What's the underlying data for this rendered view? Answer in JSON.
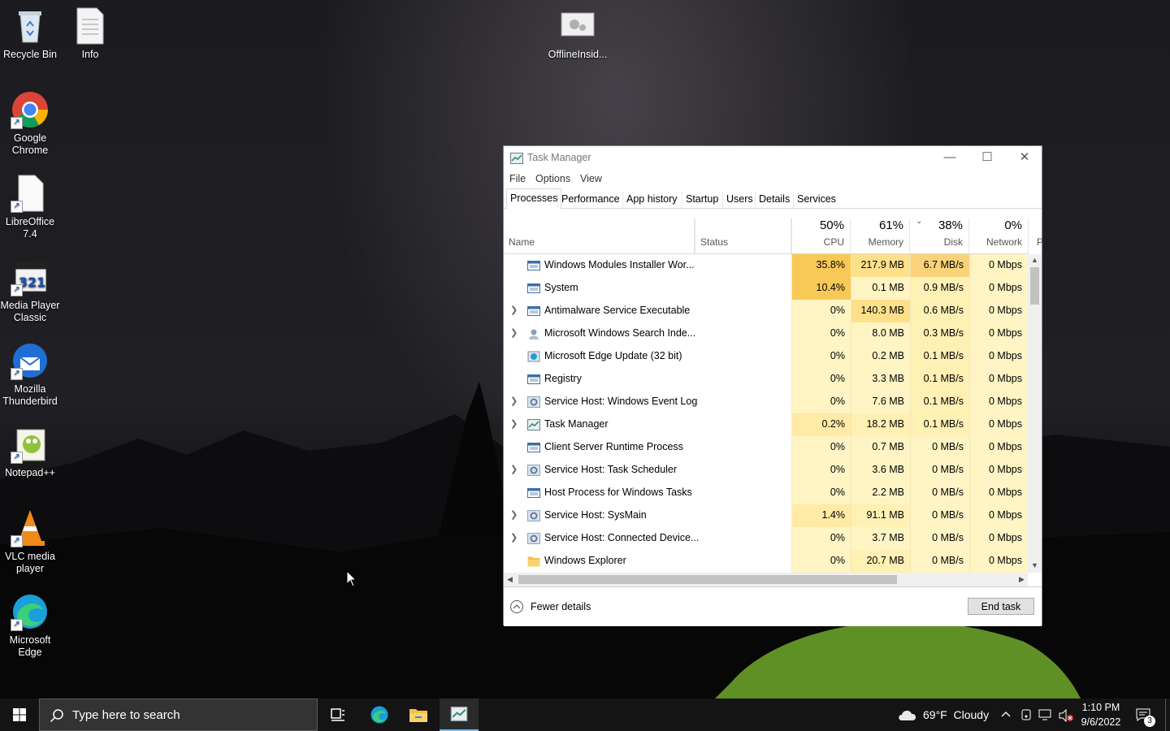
{
  "desktop": {
    "icons": [
      {
        "label": "Recycle Bin"
      },
      {
        "label": "Info"
      },
      {
        "label": "OfflineInsid..."
      },
      {
        "label": "Google Chrome"
      },
      {
        "label": "LibreOffice 7.4"
      },
      {
        "label": "Media Player Classic"
      },
      {
        "label": "Mozilla Thunderbird"
      },
      {
        "label": "Notepad++"
      },
      {
        "label": "VLC media player"
      },
      {
        "label": "Microsoft Edge"
      }
    ]
  },
  "task_manager": {
    "title": "Task Manager",
    "menu": [
      "File",
      "Options",
      "View"
    ],
    "tabs": [
      "Processes",
      "Performance",
      "App history",
      "Startup",
      "Users",
      "Details",
      "Services"
    ],
    "active_tab": "Processes",
    "columns": {
      "name": "Name",
      "status": "Status",
      "cpu": {
        "pct": "50%",
        "label": "CPU"
      },
      "memory": {
        "pct": "61%",
        "label": "Memory"
      },
      "disk": {
        "pct": "38%",
        "label": "Disk"
      },
      "network": {
        "pct": "0%",
        "label": "Network"
      },
      "power": "P"
    },
    "processes": [
      {
        "name": "Windows Modules Installer Wor...",
        "cpu": "35.8%",
        "memory": "217.9 MB",
        "disk": "6.7 MB/s",
        "network": "0 Mbps",
        "expandable": false,
        "icon": "window-app-icon"
      },
      {
        "name": "System",
        "cpu": "10.4%",
        "memory": "0.1 MB",
        "disk": "0.9 MB/s",
        "network": "0 Mbps",
        "expandable": false,
        "icon": "window-app-icon"
      },
      {
        "name": "Antimalware Service Executable",
        "cpu": "0%",
        "memory": "140.3 MB",
        "disk": "0.6 MB/s",
        "network": "0 Mbps",
        "expandable": true,
        "icon": "window-app-icon"
      },
      {
        "name": "Microsoft Windows Search Inde...",
        "cpu": "0%",
        "memory": "8.0 MB",
        "disk": "0.3 MB/s",
        "network": "0 Mbps",
        "expandable": true,
        "icon": "search-indexer-icon"
      },
      {
        "name": "Microsoft Edge Update (32 bit)",
        "cpu": "0%",
        "memory": "0.2 MB",
        "disk": "0.1 MB/s",
        "network": "0 Mbps",
        "expandable": false,
        "icon": "edge-update-icon"
      },
      {
        "name": "Registry",
        "cpu": "0%",
        "memory": "3.3 MB",
        "disk": "0.1 MB/s",
        "network": "0 Mbps",
        "expandable": false,
        "icon": "window-app-icon"
      },
      {
        "name": "Service Host: Windows Event Log",
        "cpu": "0%",
        "memory": "7.6 MB",
        "disk": "0.1 MB/s",
        "network": "0 Mbps",
        "expandable": true,
        "icon": "gear-icon"
      },
      {
        "name": "Task Manager",
        "cpu": "0.2%",
        "memory": "18.2 MB",
        "disk": "0.1 MB/s",
        "network": "0 Mbps",
        "expandable": true,
        "icon": "task-manager-icon"
      },
      {
        "name": "Client Server Runtime Process",
        "cpu": "0%",
        "memory": "0.7 MB",
        "disk": "0 MB/s",
        "network": "0 Mbps",
        "expandable": false,
        "icon": "window-app-icon"
      },
      {
        "name": "Service Host: Task Scheduler",
        "cpu": "0%",
        "memory": "3.6 MB",
        "disk": "0 MB/s",
        "network": "0 Mbps",
        "expandable": true,
        "icon": "gear-icon"
      },
      {
        "name": "Host Process for Windows Tasks",
        "cpu": "0%",
        "memory": "2.2 MB",
        "disk": "0 MB/s",
        "network": "0 Mbps",
        "expandable": false,
        "icon": "window-app-icon"
      },
      {
        "name": "Service Host: SysMain",
        "cpu": "1.4%",
        "memory": "91.1 MB",
        "disk": "0 MB/s",
        "network": "0 Mbps",
        "expandable": true,
        "icon": "gear-icon"
      },
      {
        "name": "Service Host: Connected Device...",
        "cpu": "0%",
        "memory": "3.7 MB",
        "disk": "0 MB/s",
        "network": "0 Mbps",
        "expandable": true,
        "icon": "gear-icon"
      },
      {
        "name": "Windows Explorer",
        "cpu": "0%",
        "memory": "20.7 MB",
        "disk": "0 MB/s",
        "network": "0 Mbps",
        "expandable": false,
        "icon": "folder-icon"
      }
    ],
    "fewer_details": "Fewer details",
    "end_task": "End task"
  },
  "taskbar": {
    "search_placeholder": "Type here to search",
    "weather": "69°F  Cloudy",
    "time": "1:10 PM",
    "date": "9/6/2022",
    "notifications_count": "3"
  },
  "colors": {
    "cpu_high": "#f9d27a",
    "heat_low": "#fff4c4",
    "heat_mid": "#ffe9a0",
    "taskbar": "#141414",
    "accent_blue": "#0078d4"
  }
}
